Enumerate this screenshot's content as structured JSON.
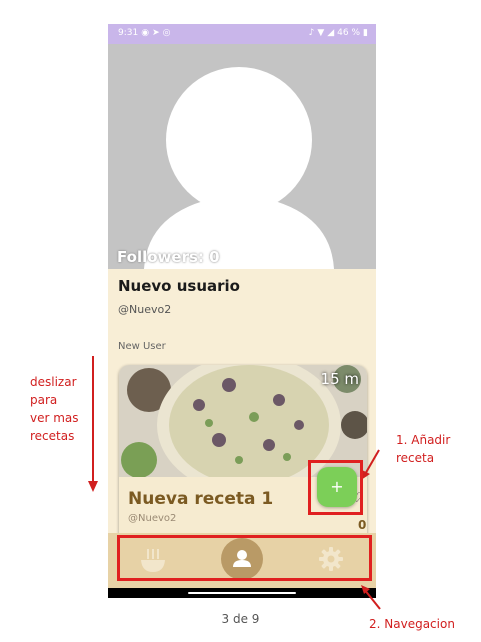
{
  "status_bar": {
    "time": "9:31",
    "battery": "46 %"
  },
  "profile": {
    "followers_label": "Followers: 0",
    "name": "Nuevo usuario",
    "handle": "@Nuevo2",
    "bio": "New User"
  },
  "recipe": {
    "time": "15 m",
    "title": "Nueva receta 1",
    "author": "@Nuevo2",
    "likes": "0"
  },
  "fab": {
    "label": "+"
  },
  "bottom_nav": {
    "items": [
      {
        "icon": "recipes-bowl-icon",
        "active": false
      },
      {
        "icon": "person-icon",
        "active": true
      },
      {
        "icon": "gear-icon",
        "active": false
      }
    ]
  },
  "annotations": {
    "swipe_lines": [
      "deslizar",
      "para",
      "ver mas",
      "recetas"
    ],
    "add_recipe_lines": [
      "1. Añadir",
      "receta"
    ],
    "navigation": "2. Navegacion"
  },
  "page_indicator": "3 de 9",
  "colors": {
    "accent_green": "#7ccf58",
    "annotation_red": "#e02020",
    "background_cream": "#f8eed6",
    "nav_bar": "#e7d2a6",
    "nav_active": "#b99a66",
    "status_bar": "#c9b6ea"
  }
}
